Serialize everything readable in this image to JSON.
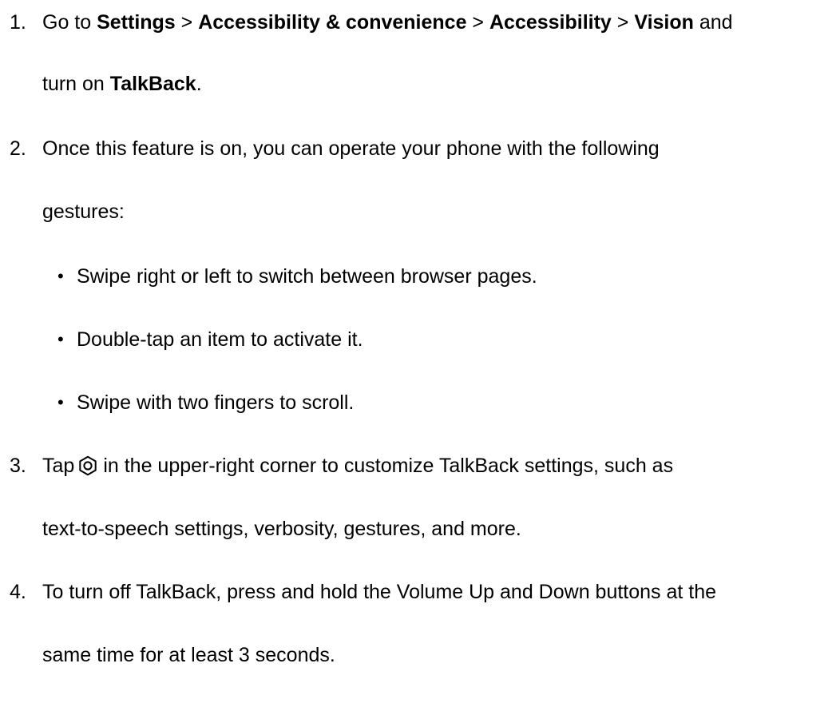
{
  "steps": [
    {
      "number": "1.",
      "line1": {
        "t1": "Go to ",
        "settings": "Settings",
        "sep1": " > ",
        "accessibility_convenience": "Accessibility & convenience",
        "sep2": " > ",
        "accessibility": "Accessibility",
        "sep3": " > ",
        "vision": "Vision",
        "t2": " and"
      },
      "line2": {
        "t1": "turn on ",
        "talkback": "TalkBack",
        "t2": "."
      }
    },
    {
      "number": "2.",
      "line1": "Once this feature is on, you can operate your phone with the following",
      "line2": "gestures:",
      "bullets": [
        "Swipe right or left to switch between browser pages.",
        "Double-tap an item to activate it.",
        "Swipe with two fingers to scroll."
      ]
    },
    {
      "number": "3.",
      "line1_before_icon": "Tap",
      "icon": "settings-gear-icon",
      "line1_after_icon": "in the upper-right corner to customize TalkBack settings, such as",
      "line2": "text-to-speech settings, verbosity, gestures, and more."
    },
    {
      "number": "4.",
      "line1": "To turn off TalkBack, press and hold the Volume Up and Down buttons at the",
      "line2": "same time for at least 3 seconds."
    }
  ],
  "bullet_symbol": "•"
}
